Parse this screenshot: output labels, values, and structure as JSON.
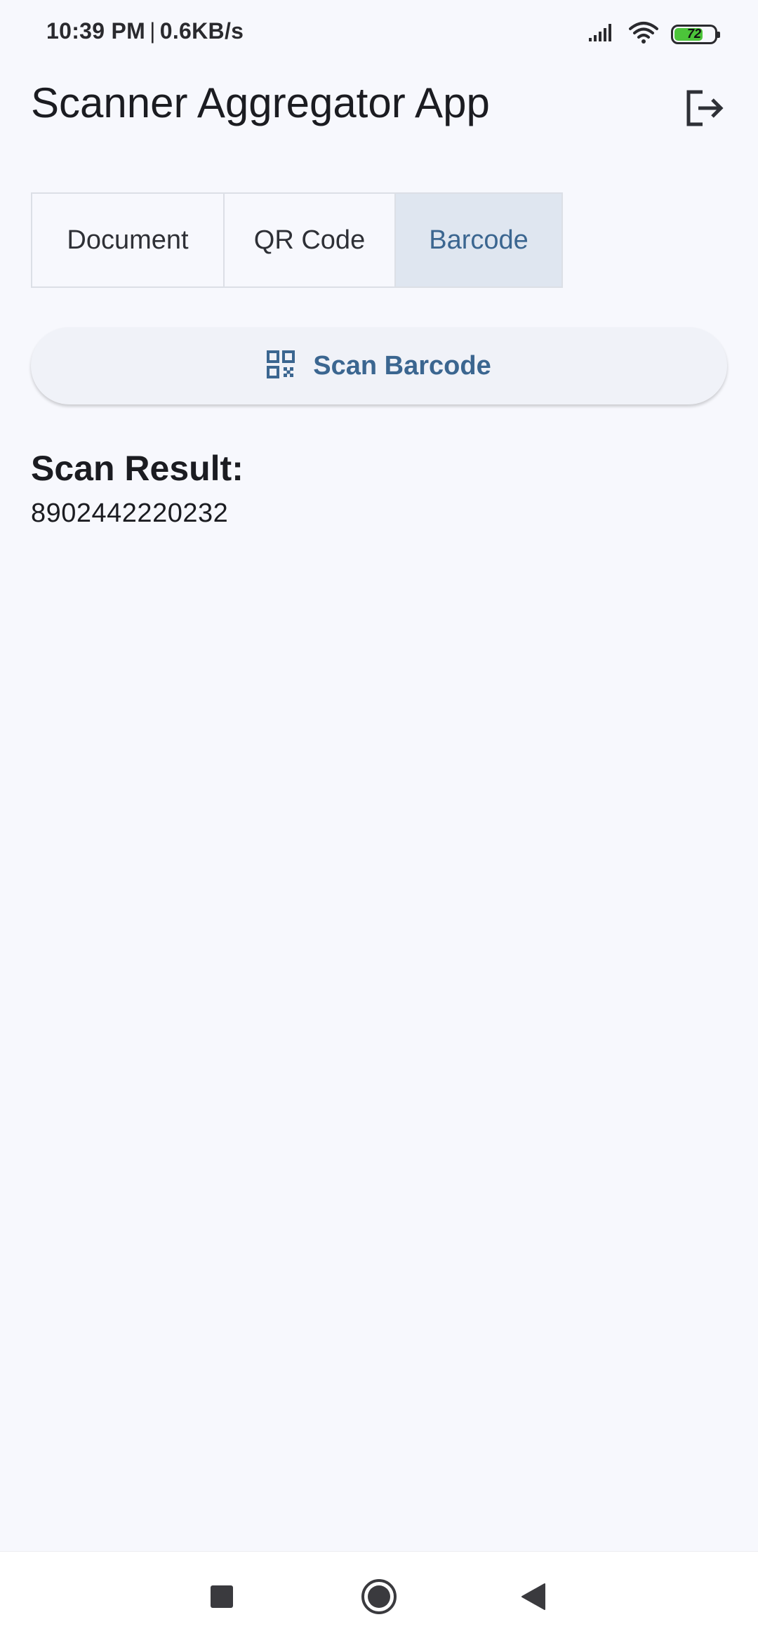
{
  "status_bar": {
    "time": "10:39 PM",
    "separator": "|",
    "speed": "0.6KB/s",
    "battery_level": "72",
    "battery_fraction": 0.72,
    "icons": [
      "signal-icon",
      "wifi-icon",
      "battery-icon"
    ]
  },
  "app_bar": {
    "title": "Scanner Aggregator App",
    "action_icon": "logout-icon"
  },
  "tabs": [
    {
      "label": "Document",
      "selected": false
    },
    {
      "label": "QR Code",
      "selected": false
    },
    {
      "label": "Barcode",
      "selected": true
    }
  ],
  "scan_button": {
    "label": "Scan Barcode",
    "icon": "qr-scan-icon"
  },
  "result": {
    "heading": "Scan Result:",
    "value": "8902442220232"
  },
  "nav_bar": {
    "icons": [
      "recents-icon",
      "home-icon",
      "back-icon"
    ]
  },
  "colors": {
    "background": "#f7f8fd",
    "accent": "#3b6690",
    "selected_tab_bg": "#dfe6f0",
    "battery_green": "#4cc43a"
  }
}
